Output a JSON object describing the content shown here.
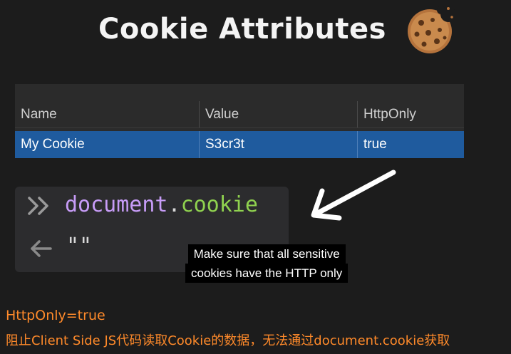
{
  "title": "Cookie Attributes",
  "table": {
    "headers": [
      "Name",
      "Value",
      "HttpOnly"
    ],
    "row": [
      "My Cookie",
      "S3cr3t",
      "true"
    ]
  },
  "console": {
    "command_object": "document",
    "command_dot": ".",
    "command_property": "cookie",
    "result": "\"\"",
    "prompt_icon": "double-chevron-right-icon",
    "return_icon": "arrow-left-icon"
  },
  "caption": {
    "line1": "Make sure that all sensitive",
    "line2": "cookies have the HTTP only"
  },
  "notes": {
    "line1": "HttpOnly=true",
    "line2": "阻止Client Side JS代码读取Cookie的数据，无法通过document.cookie获取"
  },
  "colors": {
    "background": "#1c1c1c",
    "selected_row": "#1f5b9e",
    "note_text": "#ff8a2a",
    "js_object": "#c79cf7",
    "js_property": "#8fd14f"
  }
}
